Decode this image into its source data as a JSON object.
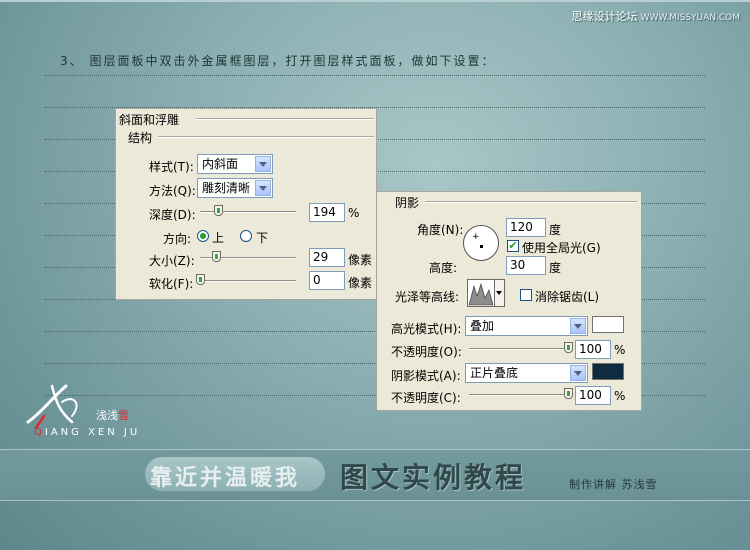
{
  "header": {
    "site_cn": "思缘设计论坛",
    "site_url": "WWW.MISSYUAN.COM",
    "instruction": "3、 图层面板中双击外金属框图层，打开图层样式面板，做如下设置："
  },
  "bevel_panel": {
    "title": "斜面和浮雕",
    "section": "结构",
    "style_label": "样式(T):",
    "style_value": "内斜面",
    "technique_label": "方法(Q):",
    "technique_value": "雕刻清晰",
    "depth_label": "深度(D):",
    "depth_value": "194",
    "depth_unit": "%",
    "direction_label": "方向:",
    "direction_up": "上",
    "direction_down": "下",
    "size_label": "大小(Z):",
    "size_value": "29",
    "size_unit": "像素",
    "soften_label": "软化(F):",
    "soften_value": "0",
    "soften_unit": "像素"
  },
  "shading_panel": {
    "title": "阴影",
    "angle_label": "角度(N):",
    "angle_value": "120",
    "angle_unit": "度",
    "global_light_label": "使用全局光(G)",
    "altitude_label": "高度:",
    "altitude_value": "30",
    "altitude_unit": "度",
    "gloss_contour_label": "光泽等高线:",
    "antialias_label": "消除锯齿(L)",
    "highlight_mode_label": "高光模式(H):",
    "highlight_mode_value": "叠加",
    "highlight_color": "#ffffff",
    "highlight_opacity_label": "不透明度(O):",
    "highlight_opacity_value": "100",
    "highlight_opacity_unit": "%",
    "shadow_mode_label": "阴影模式(A):",
    "shadow_mode_value": "正片叠底",
    "shadow_color": "#0e2b3f",
    "shadow_opacity_label": "不透明度(C):",
    "shadow_opacity_value": "100",
    "shadow_opacity_unit": "%"
  },
  "logo": {
    "cn_part1": "浅浅",
    "cn_part2": "雪",
    "en_part1": "Q",
    "en_part2": "IANG XEN JU"
  },
  "footer": {
    "pill_text": "靠近并温暖我",
    "title": "图文实例教程",
    "author": "制作讲解  苏浅雪"
  },
  "colors": {
    "accent_red": "#e02a2a",
    "dialog_bg": "#ece9d8"
  }
}
